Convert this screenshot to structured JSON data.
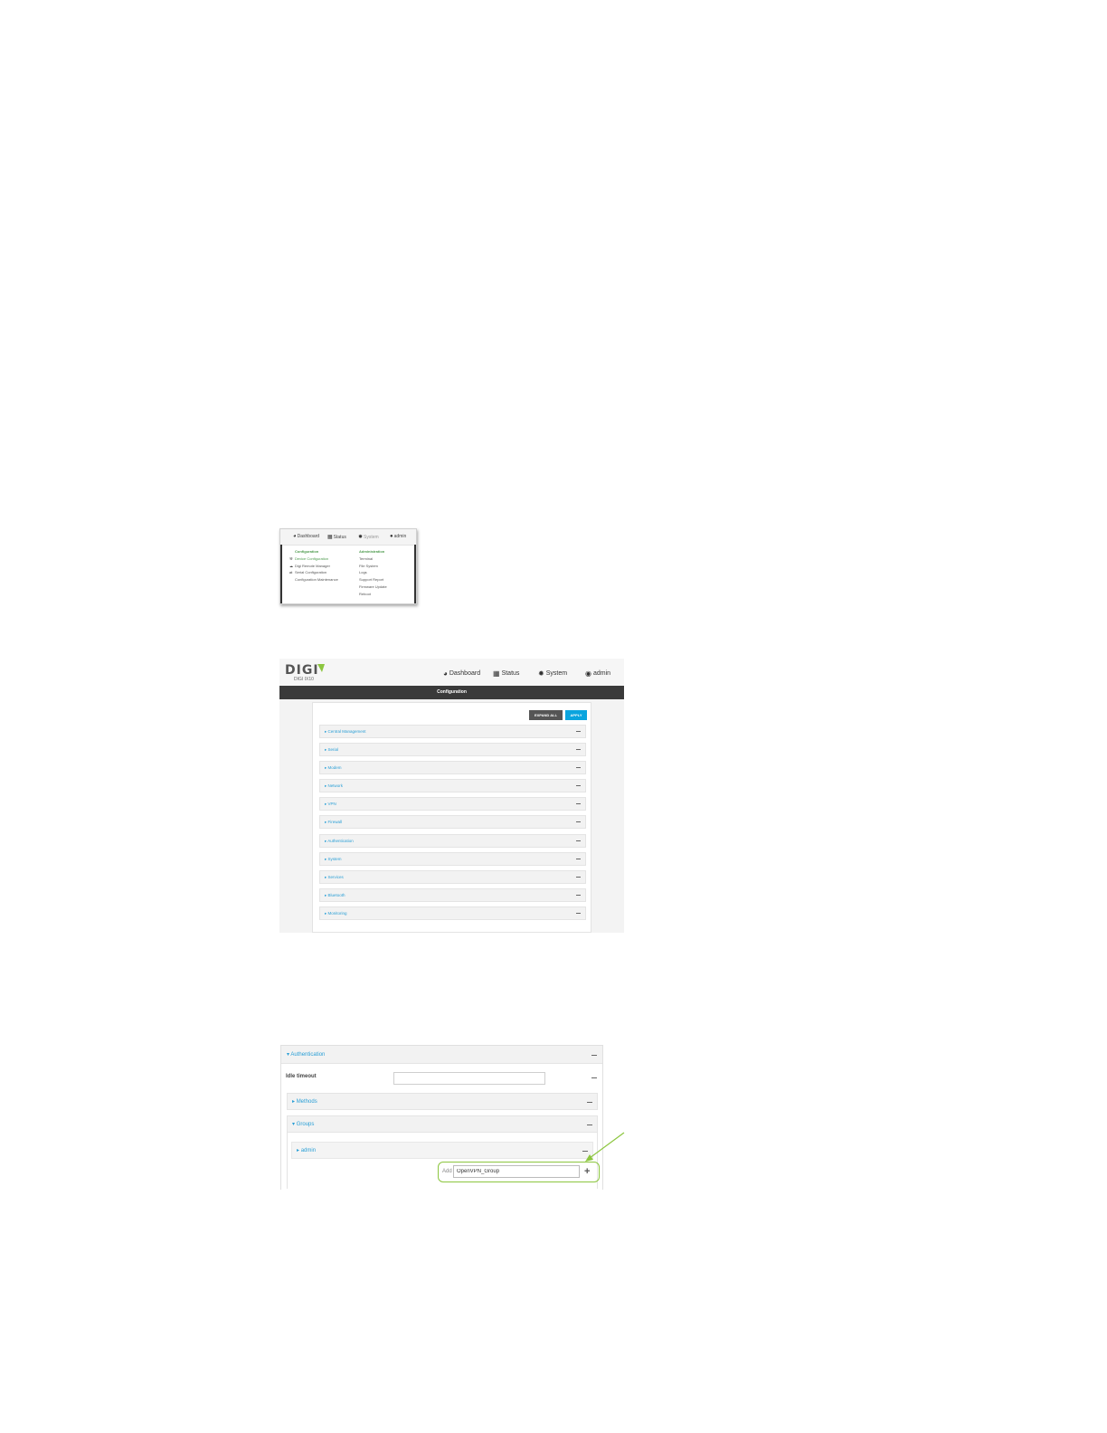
{
  "menu_shot": {
    "nav": {
      "dashboard": "Dashboard",
      "status": "Status",
      "system": "System",
      "admin": "admin"
    },
    "configuration": {
      "header": "Configuration",
      "items": [
        "Device Configuration",
        "Digi Remote Manager",
        "Serial Configuration",
        "Configuration Maintenance"
      ]
    },
    "administration": {
      "header": "Administration",
      "items": [
        "Terminal",
        "File System",
        "Logs",
        "Support Report",
        "Firmware Update",
        "Reboot"
      ]
    }
  },
  "config_shot": {
    "logo": {
      "word": "DIGI",
      "sub": "DIGI IX10"
    },
    "nav": {
      "dashboard": "Dashboard",
      "status": "Status",
      "system": "System",
      "admin": "admin"
    },
    "title": "Configuration",
    "buttons": {
      "expand_all": "EXPAND ALL",
      "apply": "APPLY"
    },
    "sections": [
      "Central Management",
      "Serial",
      "Modem",
      "Network",
      "VPN",
      "Firewall",
      "Authentication",
      "System",
      "Services",
      "Bluetooth",
      "Monitoring"
    ]
  },
  "auth_shot": {
    "authentication": "Authentication",
    "idle_timeout": "Idle timeout",
    "idle_timeout_value": "",
    "methods": "Methods",
    "groups": "Groups",
    "admin_group": "admin",
    "add_label": "Add",
    "add_value": "OpenVPN_Group"
  },
  "colors": {
    "accent_green": "#8cc63f",
    "link_blue": "#2a9fd6",
    "apply_blue": "#0aa4de",
    "title_bar": "#3a3a3a"
  }
}
